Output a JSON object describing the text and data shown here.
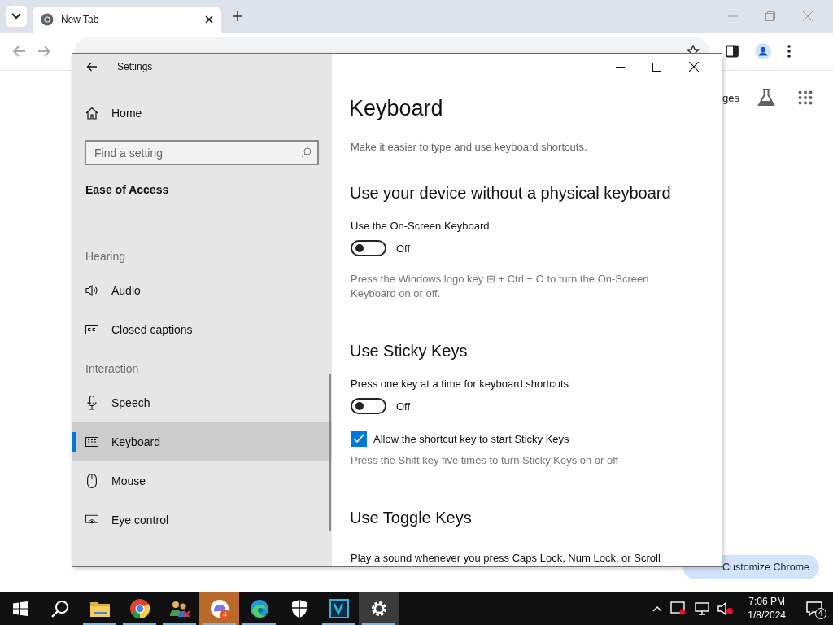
{
  "browser": {
    "tab": {
      "title": "New Tab",
      "selected": true
    },
    "shortcut_link": "ges",
    "customize_button": "Customize Chrome"
  },
  "settings": {
    "title": "Settings",
    "home": "Home",
    "search": {
      "placeholder": "Find a setting"
    },
    "category": "Ease of Access",
    "groups": [
      {
        "heading": "Hearing",
        "items": [
          {
            "label": "Audio",
            "selected": false
          },
          {
            "label": "Closed captions",
            "selected": false
          }
        ]
      },
      {
        "heading": "Interaction",
        "items": [
          {
            "label": "Speech",
            "selected": false
          },
          {
            "label": "Keyboard",
            "selected": true
          },
          {
            "label": "Mouse",
            "selected": false
          },
          {
            "label": "Eye control",
            "selected": false
          }
        ]
      }
    ],
    "page": {
      "title": "Keyboard",
      "subtitle": "Make it easier to type and use keyboard shortcuts.",
      "sections": [
        {
          "heading": "Use your device without a physical keyboard",
          "settings": [
            {
              "kind": "toggle",
              "label": "Use the On-Screen Keyboard",
              "on": false,
              "state": "Off"
            },
            {
              "kind": "hint",
              "text": "Press the Windows logo key ⊞ + Ctrl + O to turn the On-Screen Keyboard on or off."
            }
          ]
        },
        {
          "heading": "Use Sticky Keys",
          "settings": [
            {
              "kind": "toggle",
              "label": "Press one key at a time for keyboard shortcuts",
              "on": false,
              "state": "Off"
            },
            {
              "kind": "checkbox",
              "label": "Allow the shortcut key to start Sticky Keys",
              "checked": true
            },
            {
              "kind": "hint",
              "text": "Press the Shift key five times to turn Sticky Keys on or off"
            }
          ]
        },
        {
          "heading": "Use Toggle Keys",
          "settings": [
            {
              "kind": "label",
              "text": "Play a sound whenever you press Caps Lock, Num Lock, or Scroll"
            }
          ]
        }
      ]
    }
  },
  "taskbar": {
    "apps": [
      {
        "running": false,
        "active": false,
        "attention": false
      },
      {
        "running": false,
        "active": false,
        "attention": false
      },
      {
        "running": true,
        "active": false,
        "attention": false
      },
      {
        "running": true,
        "active": false,
        "attention": false
      },
      {
        "running": true,
        "active": false,
        "attention": false
      },
      {
        "running": true,
        "active": false,
        "attention": true,
        "badge": "4"
      },
      {
        "running": true,
        "active": false,
        "attention": false
      },
      {
        "running": false,
        "active": false,
        "attention": false
      },
      {
        "running": true,
        "active": false,
        "attention": false
      },
      {
        "running": true,
        "active": true,
        "attention": false
      }
    ],
    "clock": {
      "time": "7:06 PM",
      "date": "1/8/2024"
    },
    "notifications_badge": "4"
  }
}
